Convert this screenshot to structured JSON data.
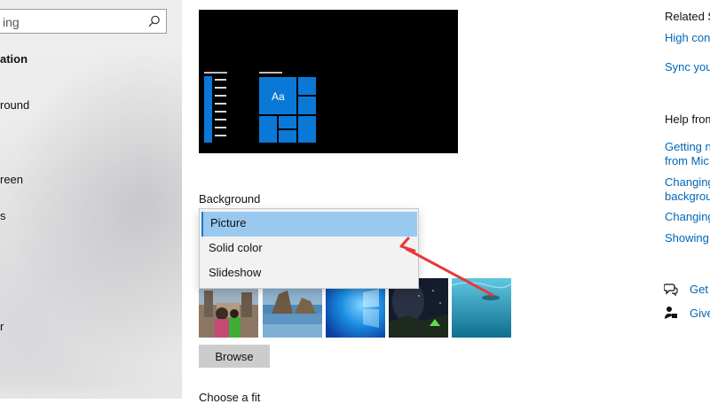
{
  "sidebar": {
    "search_placeholder": "ing",
    "items": [
      {
        "label": "ation",
        "bold": true
      },
      {
        "label": "round",
        "bold": false
      },
      {
        "label": "reen",
        "bold": false
      },
      {
        "label": "s",
        "bold": false
      },
      {
        "label": "r",
        "bold": false
      }
    ]
  },
  "preview": {
    "tile_text": "Aa"
  },
  "background": {
    "label": "Background",
    "options": [
      "Picture",
      "Solid color",
      "Slideshow"
    ],
    "selected": "Picture"
  },
  "browse_label": "Browse",
  "fit_label": "Choose a fit",
  "right": {
    "related_heading": "Related S",
    "related_links": [
      "High con",
      "Sync your"
    ],
    "help_heading": "Help from",
    "help_links": [
      "Getting n",
      "from Mic",
      "Changing",
      "backgrou",
      "Changing",
      "Showing"
    ],
    "get_help": "Get",
    "give_feedback": "Give"
  },
  "colors": {
    "accent": "#0a78d7",
    "link": "#0067b8",
    "selection": "#99c9ef",
    "annotation_arrow": "#e8373a"
  }
}
